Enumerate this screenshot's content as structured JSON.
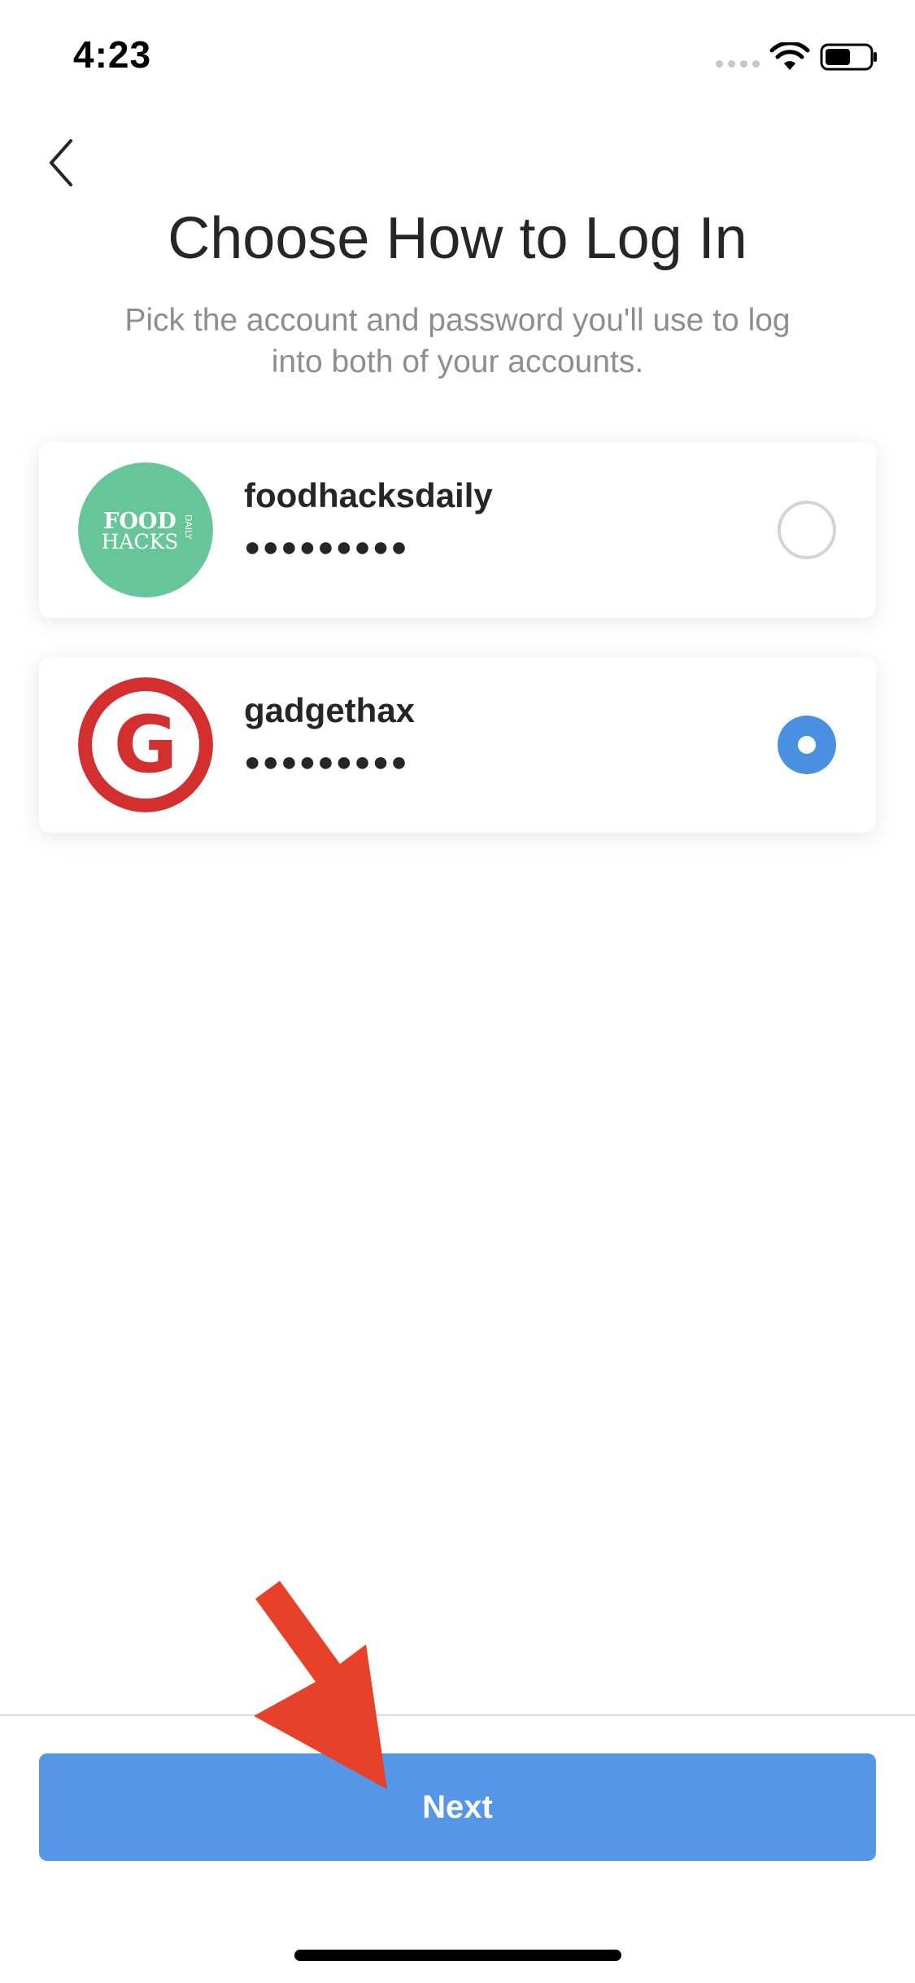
{
  "status_bar": {
    "time": "4:23",
    "icons": [
      "signal-icon",
      "wifi-icon",
      "battery-icon"
    ]
  },
  "nav": {
    "back_icon": "chevron-left-icon"
  },
  "header": {
    "title": "Choose How to Log In",
    "subtitle": "Pick the account and password you'll use to log into both of your accounts."
  },
  "accounts": [
    {
      "username": "foodhacksdaily",
      "password_mask": "●●●●●●●●●",
      "avatar": {
        "background": "#66c69a",
        "line1": "FOOD",
        "line2": "HACKS",
        "side": "DAILY"
      },
      "selected": false
    },
    {
      "username": "gadgethax",
      "password_mask": "●●●●●●●●●",
      "avatar": {
        "background": "#d32f2f",
        "letter": "G"
      },
      "selected": true
    }
  ],
  "footer": {
    "next_label": "Next"
  },
  "colors": {
    "accent": "#4a90e2",
    "button": "#5596e6",
    "annotation_arrow": "#e8412a"
  }
}
